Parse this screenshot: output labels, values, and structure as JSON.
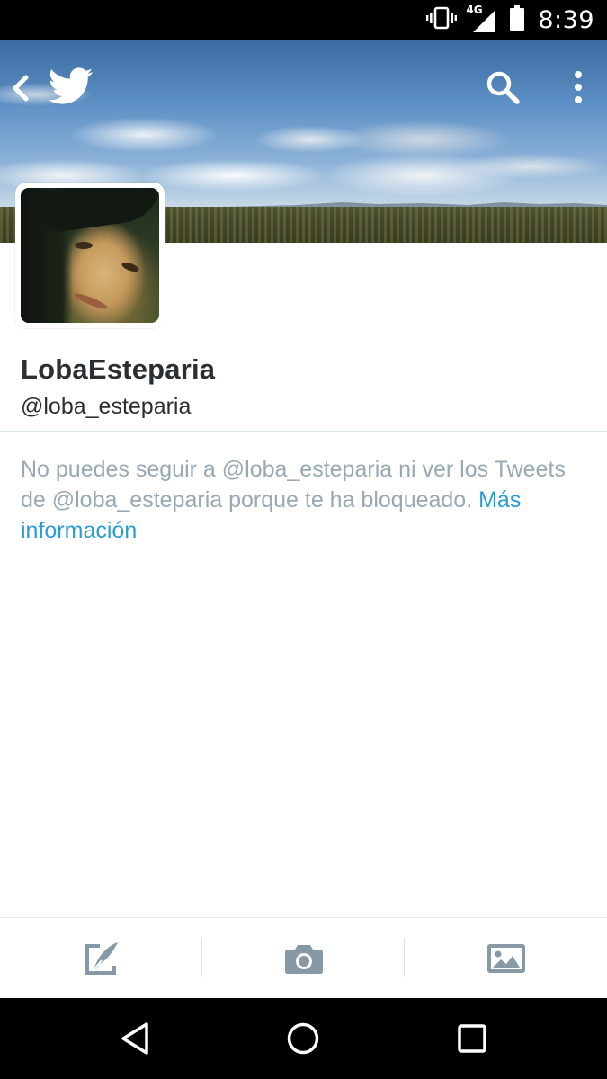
{
  "status_bar": {
    "time": "8:39",
    "network_label": "4G",
    "icons": [
      "vibrate-icon",
      "signal-icon",
      "battery-icon"
    ]
  },
  "header": {
    "icons": [
      "back-icon",
      "twitter-bird-icon",
      "search-icon",
      "more-vert-icon"
    ]
  },
  "profile": {
    "display_name": "LobaEsteparia",
    "handle": "@loba_esteparia"
  },
  "blocked_notice": {
    "text": "No puedes seguir a @loba_esteparia ni ver los Tweets de @loba_esteparia porque te ha bloqueado. ",
    "link_label": "Más información"
  },
  "compose_bar": {
    "icons": [
      "compose-tweet-icon",
      "camera-icon",
      "gallery-icon"
    ]
  },
  "nav_bar": {
    "icons": [
      "nav-back-icon",
      "nav-home-icon",
      "nav-recents-icon"
    ]
  },
  "colors": {
    "link": "#2b9bd6",
    "muted_text": "#99a8b3",
    "primary_text": "#292f33",
    "icon_gray": "#8899a6"
  }
}
